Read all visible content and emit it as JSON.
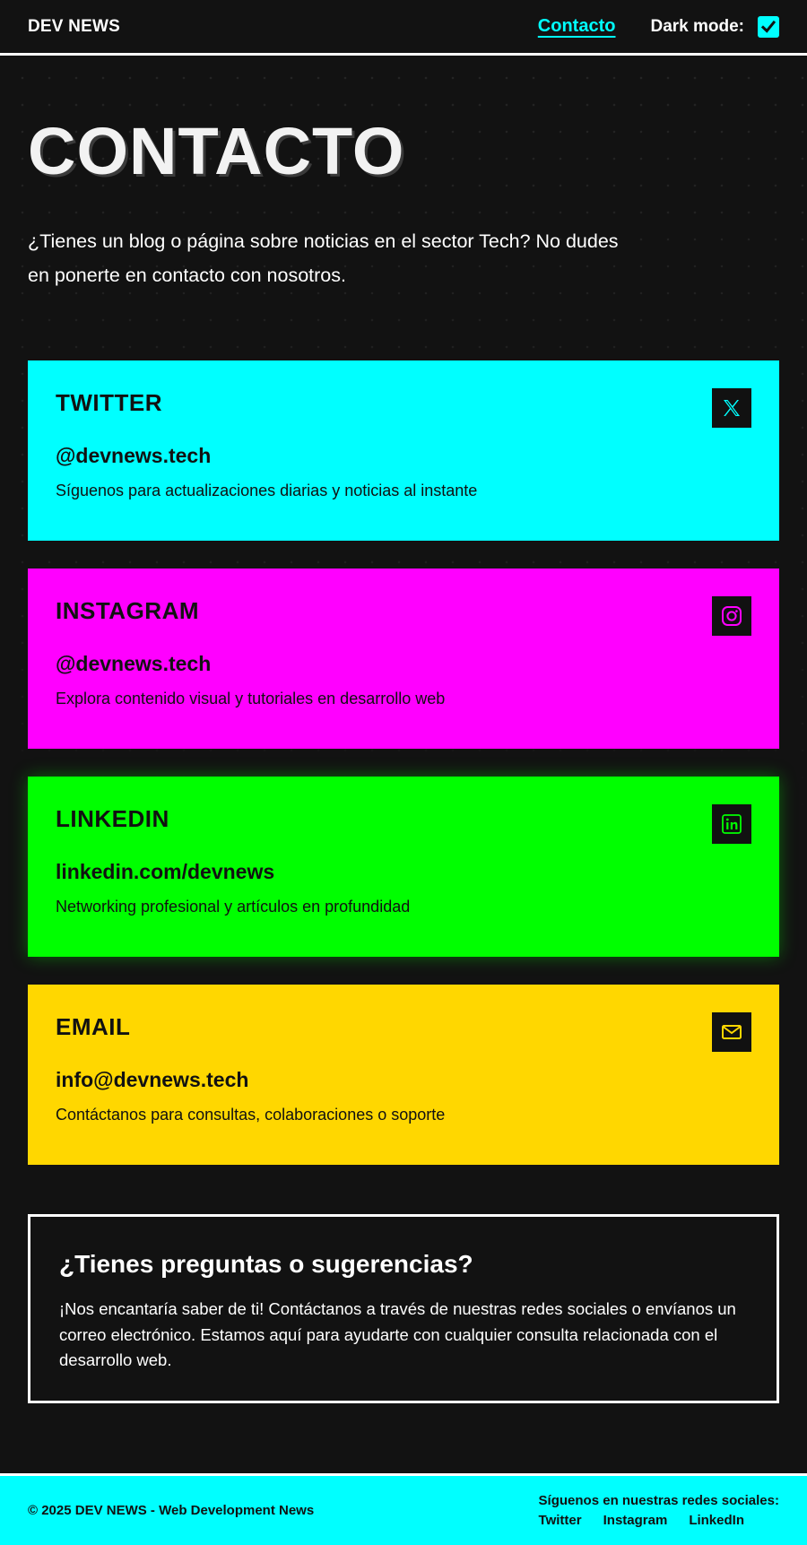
{
  "header": {
    "brand": "DEV NEWS",
    "nav_link": "Contacto",
    "dark_mode_label": "Dark mode:",
    "dark_mode_checked": true
  },
  "hero": {
    "title": "CONTACTO",
    "subtitle": "¿Tienes un blog o página sobre noticias en el sector Tech? No dudes en ponerte en contacto con nosotros."
  },
  "cards": [
    {
      "title": "TWITTER",
      "handle": "@devnews.tech",
      "description": "Síguenos para actualizaciones diarias y noticias al instante",
      "icon": "x-logo-icon",
      "color": "#00ffff"
    },
    {
      "title": "INSTAGRAM",
      "handle": "@devnews.tech",
      "description": "Explora contenido visual y tutoriales en desarrollo web",
      "icon": "instagram-icon",
      "color": "#ff00ff"
    },
    {
      "title": "LINKEDIN",
      "handle": "linkedin.com/devnews",
      "description": "Networking profesional y artículos en profundidad",
      "icon": "linkedin-icon",
      "color": "#00ff00"
    },
    {
      "title": "EMAIL",
      "handle": "info@devnews.tech",
      "description": "Contáctanos para consultas, colaboraciones o soporte",
      "icon": "mail-icon",
      "color": "#ffd700"
    }
  ],
  "questions": {
    "title": "¿Tienes preguntas o sugerencias?",
    "text": "¡Nos encantaría saber de ti! Contáctanos a través de nuestras redes sociales o envíanos un correo electrónico. Estamos aquí para ayudarte con cualquier consulta relacionada con el desarrollo web."
  },
  "footer": {
    "copyright": "© 2025 DEV NEWS - Web Development News",
    "social_title": "Síguenos en nuestras redes sociales:",
    "links": [
      "Twitter",
      "Instagram",
      "LinkedIn"
    ]
  },
  "colors": {
    "background": "#121212",
    "accent": "#00ffff",
    "magenta": "#ff00ff",
    "green": "#00ff00",
    "yellow": "#ffd700"
  }
}
